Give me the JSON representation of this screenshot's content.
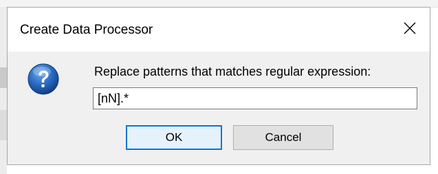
{
  "dialog": {
    "title": "Create Data Processor",
    "prompt": "Replace patterns that matches regular expression:",
    "input_value": "[nN].*",
    "ok_label": "OK",
    "cancel_label": "Cancel",
    "close_icon": "close-icon",
    "question_icon": "question-icon"
  },
  "colors": {
    "title_bar": "#ffffff",
    "dialog_body": "#f0f0f0",
    "default_button_border": "#0078d7",
    "question_icon_fill": "#1c5fb3"
  }
}
